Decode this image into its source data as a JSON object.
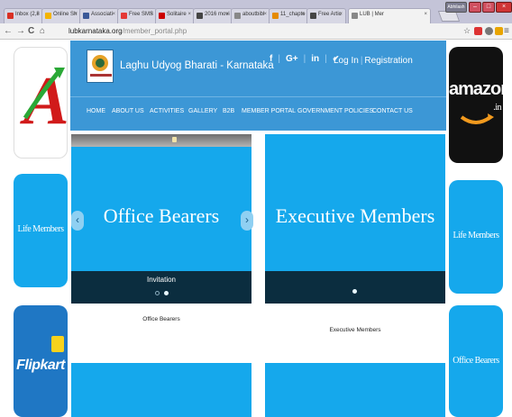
{
  "browser": {
    "tabs": [
      {
        "label": "Inbox (2,8",
        "color": "#d93025"
      },
      {
        "label": "Online Sh",
        "color": "#f4b400"
      },
      {
        "label": "Associati",
        "color": "#3b5998"
      },
      {
        "label": "Free SMS",
        "color": "#e53935"
      },
      {
        "label": "Solitaire",
        "color": "#cc0000"
      },
      {
        "label": "2016 movi",
        "color": "#444444"
      },
      {
        "label": "aboutbibl",
        "color": "#888888"
      },
      {
        "label": "11_chapte",
        "color": "#e58a00"
      },
      {
        "label": "Free Artic",
        "color": "#444444"
      },
      {
        "label": "LUB | Mer",
        "color": "#888888",
        "active": true
      }
    ],
    "window_user": "Abhilash",
    "url_host": "lubkarnataka.org",
    "url_path": "/member_portal.php",
    "nav": {
      "back": "←",
      "forward": "→",
      "reload": "C",
      "home": "⌂"
    }
  },
  "header": {
    "site_title": "Laghu Udyog Bharati - Karnataka",
    "social": {
      "facebook": "f",
      "gplus": "G+",
      "linkedin": "in",
      "twitter": "🐦"
    },
    "login": "Log In",
    "registration": "Registration"
  },
  "menu": {
    "items": [
      "HOME",
      "ABOUT US",
      "ACTIVITIES",
      "GALLERY",
      "B2B",
      "MEMBER PORTAL",
      "GOVERNMENT POLICIES",
      "CONTACT US"
    ]
  },
  "ads": {
    "left_top_letter": "A",
    "left_mid_label": "Life Members",
    "left_bottom_label": "Flipkart",
    "right_top_label": "amazon",
    "right_top_suffix": ".in",
    "right_mid_label": "Life Members",
    "right_bottom_label": "Office Bearers"
  },
  "slider_left": {
    "title": "Office Bearers",
    "caption": "Invitation",
    "prev": "‹",
    "next": "›"
  },
  "slider_right": {
    "title": "Executive Members"
  },
  "labels": {
    "office_bearers": "Office Bearers",
    "executive_members": "Executive Members"
  },
  "colors": {
    "header_blue": "#3c97d6",
    "tile_blue": "#15a8ec",
    "caption_dark": "#0b2d3f"
  }
}
